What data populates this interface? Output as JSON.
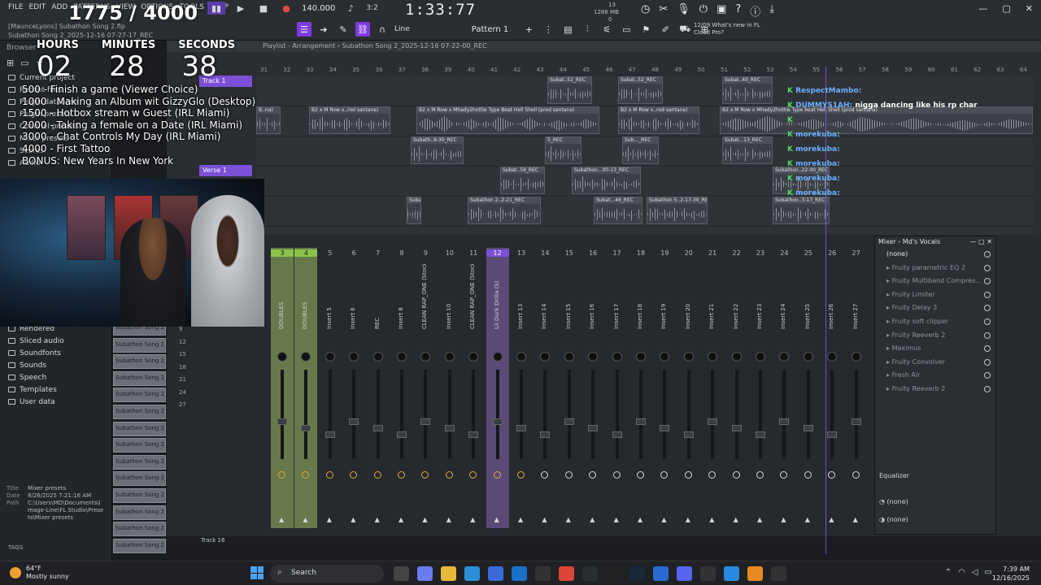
{
  "menu": [
    "FILE",
    "EDIT",
    "ADD",
    "PATTERNS",
    "VIEW",
    "OPTIONS",
    "TOOLS",
    "HELP"
  ],
  "project": {
    "user": "[MaunceLyons]",
    "file": "Subathon Song 2.flp",
    "name": "Subathon Song 2_2025-12-16 07-27-17_REC"
  },
  "counter": "1775 / 4000",
  "transport": {
    "tempo": "140.000",
    "time": "1:33:77",
    "time_sig": "3:2",
    "cpu": "13",
    "ram": "1286 MB",
    "voices": "0"
  },
  "toolbar": {
    "snap": "Line",
    "pattern": "Pattern 1"
  },
  "news": {
    "date": "12/09",
    "title": "What's new in FL",
    "subtitle": "Cloud Pro?"
  },
  "playlist": {
    "title": "Playlist - Arrangement",
    "path": "Subathon Song 2_2025-12-16 07-22-00_REC",
    "bars": [
      "31",
      "32",
      "33",
      "34",
      "35",
      "36",
      "37",
      "38",
      "39",
      "40",
      "41",
      "42",
      "43",
      "44",
      "45",
      "46",
      "47",
      "48",
      "49",
      "50",
      "51",
      "52",
      "53",
      "54",
      "55",
      "56",
      "57",
      "58",
      "59",
      "60",
      "61",
      "62",
      "63",
      "64"
    ],
    "markers": [
      "Track 1",
      "Verse 1"
    ],
    "track_last": "Track 16"
  },
  "clips": [
    "Subat..52_REC",
    "Subat..52_REC",
    "Subat..40_REC",
    "B..na)",
    "B2 x M Row x..rod santana)",
    "B2 x M Row x Mhady2hottie Type Beat Hell Shell (prod santana)",
    "B2 x M Row x..rod santana)",
    "B2 x M Row x Mhady2hottie Type beat Hell Shell (prod santana)",
    "Subath..9-30_REC",
    "5_REC",
    "Sub..._REC",
    "Subat...13_REC",
    "Subat..59_REC",
    "Subathon...00-13_REC",
    "Subat...46_REC",
    "Subathon..22-00_REC",
    "Subathon..3-17_REC",
    "Subath..0-06_REC",
    "Subathon 2..2-21_REC",
    "Subathon 5..2-17-30_REC"
  ],
  "chat": [
    {
      "user": "RespectMambo:",
      "msg": ""
    },
    {
      "user": "DUMMYS1AH:",
      "msg": "nigga dancing like his rp char"
    },
    {
      "user": "",
      "msg": ""
    },
    {
      "user": "morekuba:",
      "msg": ""
    },
    {
      "user": "morekuba:",
      "msg": ""
    },
    {
      "user": "morekuba:",
      "msg": ""
    },
    {
      "user": "morekuba:",
      "msg": ""
    },
    {
      "user": "morekuba:",
      "msg": ""
    }
  ],
  "timers": {
    "h_label": "HOURS",
    "m_label": "MINUTES",
    "s_label": "SECONDS",
    "h": "02",
    "m": "28",
    "s": "38"
  },
  "goals": [
    "500 - Finish a game (Viewer Choice)",
    "1000 - Making an Album wit GizzyGlo (Desktop)",
    "1500 - Hotbox stream w Guest (IRL Miami)",
    "2000 - Taking a female on a Date (IRL Miami)",
    "3000 - Chat Controls My Day (IRL Miami)",
    "4000 - First Tattoo",
    "BONUS: New Years In New York"
  ],
  "browser": {
    "title": "Browser",
    "items": [
      "Current project",
      "Recent files",
      "Plugin database",
      "Plugin presets",
      "Channel presets",
      "Mixer presets",
      "Scores",
      "Audio"
    ],
    "items_lower": [
      "Rendered",
      "Sliced audio",
      "Soundfonts",
      "Sounds",
      "Speech",
      "Templates",
      "User data"
    ],
    "meta": {
      "title_k": "Title",
      "title": "Mixer presets",
      "date_k": "Date",
      "date": "8/26/2025 7:21:16 AM",
      "path_k": "Path",
      "path": "C:\\Users\\MD\\Documents\\Image-Line\\FL Studio\\Presets\\Mixer presets"
    },
    "tags": "TAGS"
  },
  "cliplist": [
    "Subathon Song 2_20",
    "Subathon Song 2_20",
    "Subathon Song 2_20",
    "Subathon Song 2_20",
    "Subathon Song 2_20",
    "Subathon Song 2_20",
    "Subathon Song 2_20",
    "Subathon Song 2_20",
    "Subathon Song 2_20",
    "Subathon Song 2_20",
    "Subathon Song 2_20",
    "Subathon Song 2_20",
    "Subathon Song 2_20",
    "Subathon Song 2_2025-1"
  ],
  "mixer": {
    "strips": [
      {
        "n": "3",
        "name": "DOUBLES",
        "style": "green"
      },
      {
        "n": "4",
        "name": "DOUBLES",
        "style": "green"
      },
      {
        "n": "5",
        "name": "Insert 5"
      },
      {
        "n": "6",
        "name": "Insert 6"
      },
      {
        "n": "7",
        "name": "REC"
      },
      {
        "n": "8",
        "name": "Insert 8"
      },
      {
        "n": "9",
        "name": "CLEAN RAP_ONE (Stock)"
      },
      {
        "n": "10",
        "name": "Insert 10"
      },
      {
        "n": "11",
        "name": "CLEAN RAP_ONE (Stock)"
      },
      {
        "n": "12",
        "name": "Lil Durk Drilla (S)",
        "style": "purple"
      },
      {
        "n": "13",
        "name": "Insert 13"
      },
      {
        "n": "14",
        "name": "Insert 14"
      },
      {
        "n": "15",
        "name": "Insert 15"
      },
      {
        "n": "16",
        "name": "Insert 16"
      },
      {
        "n": "17",
        "name": "Insert 17"
      },
      {
        "n": "18",
        "name": "Insert 18"
      },
      {
        "n": "19",
        "name": "Insert 19"
      },
      {
        "n": "20",
        "name": "Insert 20"
      },
      {
        "n": "21",
        "name": "Insert 21"
      },
      {
        "n": "22",
        "name": "Insert 22"
      },
      {
        "n": "23",
        "name": "Insert 23"
      },
      {
        "n": "24",
        "name": "Insert 24"
      },
      {
        "n": "25",
        "name": "Insert 25"
      },
      {
        "n": "26",
        "name": "Insert 26"
      },
      {
        "n": "27",
        "name": "Insert 27"
      }
    ],
    "numbers_left": [
      "9",
      "12",
      "15",
      "18",
      "21",
      "24",
      "27"
    ]
  },
  "inserts": {
    "title": "Mixer - Md's Vocals",
    "preset": "(none)",
    "slots": [
      "Fruity parametric EQ 2",
      "Fruity Multiband Compres...",
      "Fruity Limiter",
      "Fruity Delay 3",
      "Fruity soft clipper",
      "Fruity Reeverb 2",
      "Maximus",
      "Fruity Convolver",
      "Fresh Air",
      "Fruity Reeverb 2"
    ],
    "eq_label": "Equalizer",
    "out1": "(none)",
    "out2": "(none)"
  },
  "taskbar": {
    "temp": "64°F",
    "weather": "Mostly sunny",
    "search": "Search",
    "time": "7:39 AM",
    "date": "12/16/2025"
  },
  "colors": {
    "accent": "#7c3be0",
    "green": "#8bc34a",
    "bg": "#1b1d20"
  }
}
